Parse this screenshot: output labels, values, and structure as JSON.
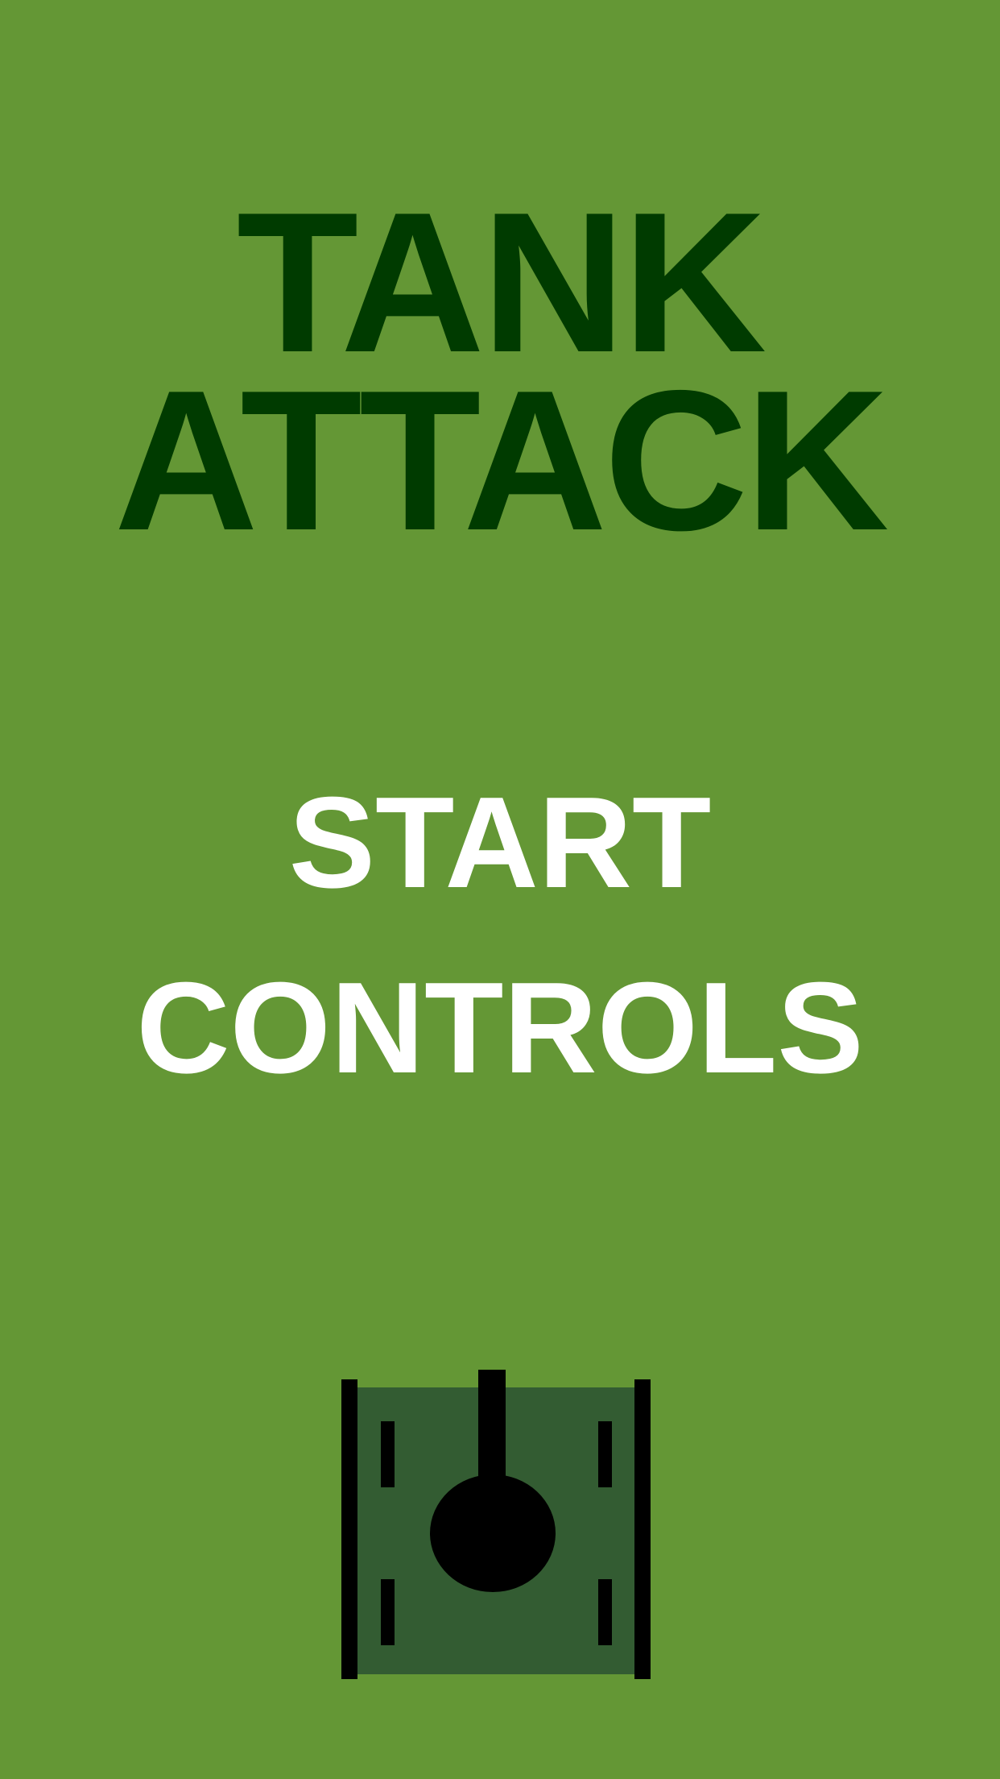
{
  "title": {
    "line1": "TANK",
    "line2": "ATTACK"
  },
  "menu": {
    "start_label": "START",
    "controls_label": "CONTROLS"
  },
  "tank": {
    "icon": "tank-icon",
    "body_color": "#335c32",
    "detail_color": "#000000"
  },
  "colors": {
    "background": "#649735",
    "title": "#003b00",
    "menu_text": "#ffffff"
  }
}
